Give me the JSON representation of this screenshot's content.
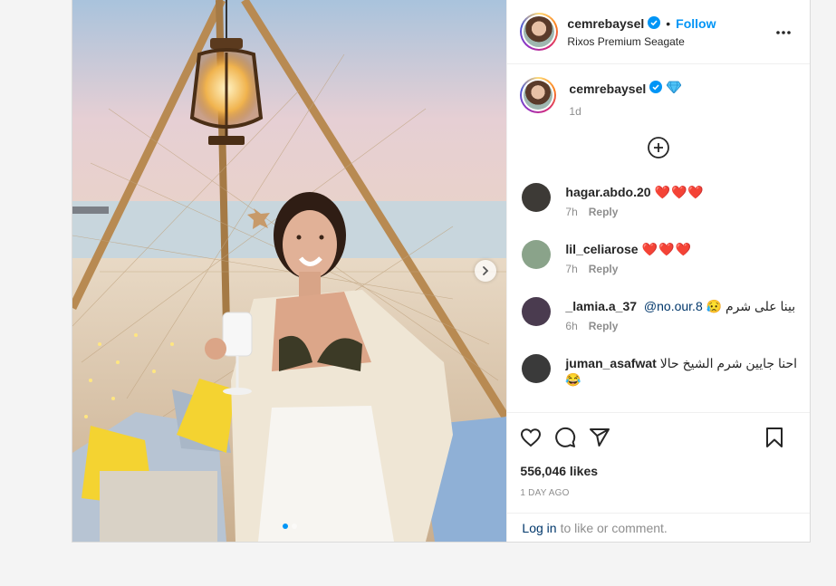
{
  "post": {
    "username": "cemrebaysel",
    "follow_label": "Follow",
    "separator": "•",
    "location": "Rixos Premium Seagate",
    "caption_time": "1d",
    "likes": "556,046 likes",
    "date": "1 DAY AGO",
    "login_link": "Log in",
    "login_rest": "to like or comment."
  },
  "comments": [
    {
      "user": "hagar.abdo.20",
      "text": "❤️❤️❤️",
      "time": "7h",
      "reply": "Reply",
      "avatar_color": "#3d3a36"
    },
    {
      "user": "lil_celiarose",
      "text": "❤️❤️❤️",
      "time": "7h",
      "reply": "Reply",
      "avatar_color": "#8aa38a"
    },
    {
      "user": "_lamia.a_37",
      "mention": "@no.our.8",
      "text": "بينا على شرم 😥",
      "time": "6h",
      "reply": "Reply",
      "avatar_color": "#4a3b4f"
    },
    {
      "user": "juman_asafwat",
      "text": "احنا جايين شرم الشيخ حالا 😂",
      "avatar_color": "#3a3a3a"
    }
  ],
  "icons": {
    "verified": "verified-badge-icon",
    "more": "more-options-icon",
    "load_more": "plus-circle-icon",
    "like": "heart-icon",
    "comment": "comment-icon",
    "share": "share-icon",
    "save": "bookmark-icon",
    "next": "chevron-right-icon"
  },
  "colors": {
    "accent": "#0095f6",
    "link": "#00376b",
    "muted": "#8e8e8e"
  },
  "carousel": {
    "slides": 2,
    "active": 0
  }
}
